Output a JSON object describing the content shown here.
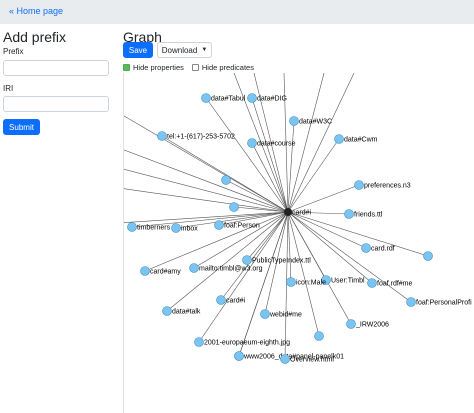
{
  "nav": {
    "home_link": "« Home page"
  },
  "prefix_form": {
    "title": "Add prefix",
    "prefix_label": "Prefix",
    "prefix_value": "",
    "iri_label": "IRI",
    "iri_value": "",
    "submit_label": "Submit"
  },
  "graph": {
    "title": "Graph",
    "save_label": "Save",
    "download_label": "Download",
    "hide_properties_label": "Hide properties",
    "hide_properties_checked": true,
    "hide_predicates_label": "Hide predicates",
    "hide_predicates_checked": false,
    "node_color": "#7cc4f0",
    "node_stroke": "#3a8fc4",
    "center_label": "card#i",
    "nodes": [
      {
        "label": "data#Tabul"
      },
      {
        "label": "data#DIG"
      },
      {
        "label": "data#W3C"
      },
      {
        "label": "tel:+1-(617)-253-5702"
      },
      {
        "label": "data#course"
      },
      {
        "label": "data#Cwm"
      },
      {
        "label": ""
      },
      {
        "label": "preferences.n3"
      },
      {
        "label": ""
      },
      {
        "label": "friends.ttl"
      },
      {
        "label": "timberners"
      },
      {
        "label": "inbox"
      },
      {
        "label": "foaf:Person"
      },
      {
        "label": "card.rdf"
      },
      {
        "label": ""
      },
      {
        "label": "PublicTypeIndex.ttl"
      },
      {
        "label": "card#amy"
      },
      {
        "label": "mailto:timbl@w3.org"
      },
      {
        "label": "User:Timbl"
      },
      {
        "label": "foaf.rdf#me"
      },
      {
        "label": "icon:Male"
      },
      {
        "label": "data#talk"
      },
      {
        "label": "card#i"
      },
      {
        "label": "foaf:PersonalProfi"
      },
      {
        "label": "webid#me"
      },
      {
        "label": ""
      },
      {
        "label": "_IRW2006"
      },
      {
        "label": "2001-europaeum-eighth.jpg"
      },
      {
        "label": ""
      },
      {
        "label": "www2006_data#panel-panelk01"
      },
      {
        "label": "Overview.html"
      }
    ]
  }
}
